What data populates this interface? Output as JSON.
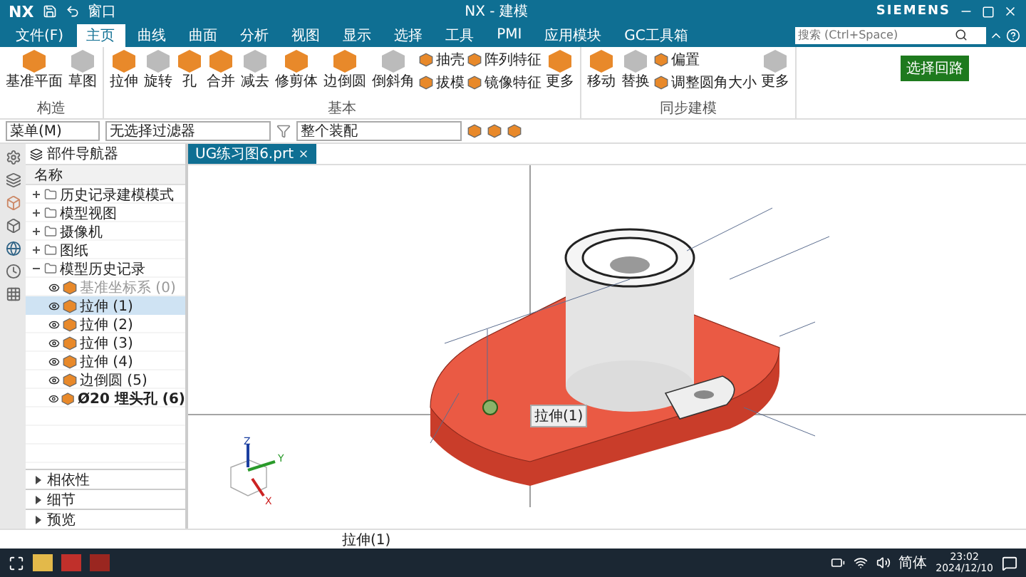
{
  "title_bar": {
    "app": "NX",
    "window_menu": "窗口",
    "title": "NX - 建模",
    "brand": "SIEMENS"
  },
  "menu_tabs": [
    {
      "label": "文件(F)",
      "selected": false
    },
    {
      "label": "主页",
      "selected": true
    },
    {
      "label": "曲线",
      "selected": false
    },
    {
      "label": "曲面",
      "selected": false
    },
    {
      "label": "分析",
      "selected": false
    },
    {
      "label": "视图",
      "selected": false
    },
    {
      "label": "显示",
      "selected": false
    },
    {
      "label": "选择",
      "selected": false
    },
    {
      "label": "工具",
      "selected": false
    },
    {
      "label": "PMI",
      "selected": false
    },
    {
      "label": "应用模块",
      "selected": false
    },
    {
      "label": "GC工具箱",
      "selected": false
    }
  ],
  "search": {
    "placeholder": "搜索 (Ctrl+Space)"
  },
  "ribbon": {
    "groups": [
      {
        "title": "构造",
        "items": [
          {
            "label": "基准平面",
            "kind": "large"
          },
          {
            "label": "草图",
            "kind": "large"
          }
        ]
      },
      {
        "title": "基本",
        "items": [
          {
            "label": "拉伸",
            "kind": "large"
          },
          {
            "label": "旋转",
            "kind": "large"
          },
          {
            "label": "孔",
            "kind": "large"
          },
          {
            "label": "合并",
            "kind": "large"
          },
          {
            "label": "减去",
            "kind": "large"
          },
          {
            "label": "修剪体",
            "kind": "large"
          },
          {
            "label": "边倒圆",
            "kind": "large"
          },
          {
            "label": "倒斜角",
            "kind": "large"
          },
          {
            "label": "抽壳",
            "kind": "small"
          },
          {
            "label": "拔模",
            "kind": "small"
          },
          {
            "label": "阵列特征",
            "kind": "small"
          },
          {
            "label": "镜像特征",
            "kind": "small"
          },
          {
            "label": "更多",
            "kind": "large"
          }
        ]
      },
      {
        "title": "同步建模",
        "items": [
          {
            "label": "移动",
            "kind": "large"
          },
          {
            "label": "替换",
            "kind": "large"
          },
          {
            "label": "偏置",
            "kind": "small"
          },
          {
            "label": "调整圆角大小",
            "kind": "small"
          },
          {
            "label": "更多",
            "kind": "large"
          }
        ]
      }
    ]
  },
  "selection_widget": {
    "label": "选择回路"
  },
  "toolbar": {
    "menu": "菜单(M)",
    "filter": "无选择过滤器",
    "scope": "整个装配"
  },
  "navigator": {
    "title": "部件导航器",
    "column": "名称",
    "tree": [
      {
        "label": "历史记录建模模式",
        "selected": false,
        "expanded": false
      },
      {
        "label": "模型视图",
        "selected": false,
        "expanded": false
      },
      {
        "label": "摄像机",
        "selected": false,
        "expanded": false
      },
      {
        "label": "图纸",
        "selected": false,
        "expanded": false
      },
      {
        "label": "模型历史记录",
        "selected": false,
        "expanded": true,
        "children": [
          {
            "label": "基准坐标系 (0)",
            "selected": false,
            "disabled": true,
            "current": false
          },
          {
            "label": "拉伸 (1)",
            "selected": true,
            "disabled": false,
            "current": false
          },
          {
            "label": "拉伸 (2)",
            "selected": false,
            "disabled": false,
            "current": false
          },
          {
            "label": "拉伸 (3)",
            "selected": false,
            "disabled": false,
            "current": false
          },
          {
            "label": "拉伸 (4)",
            "selected": false,
            "disabled": false,
            "current": false
          },
          {
            "label": "边倒圆 (5)",
            "selected": false,
            "disabled": false,
            "current": false
          },
          {
            "label": "Ø20 埋头孔 (6)",
            "selected": false,
            "disabled": false,
            "current": true
          }
        ]
      }
    ],
    "panels": [
      {
        "label": "相依性",
        "expanded": false
      },
      {
        "label": "细节",
        "expanded": false
      },
      {
        "label": "预览",
        "expanded": false
      }
    ]
  },
  "document_tab": {
    "label": "UG练习图6.prt"
  },
  "viewport": {
    "tooltip": "拉伸(1)",
    "triad": {
      "z": "Z",
      "y": "Y",
      "x": "X"
    }
  },
  "status_bar": {
    "text": "拉伸(1)"
  },
  "taskbar": {
    "ime": "简体",
    "time": "23:02",
    "date": "2024/12/10"
  }
}
